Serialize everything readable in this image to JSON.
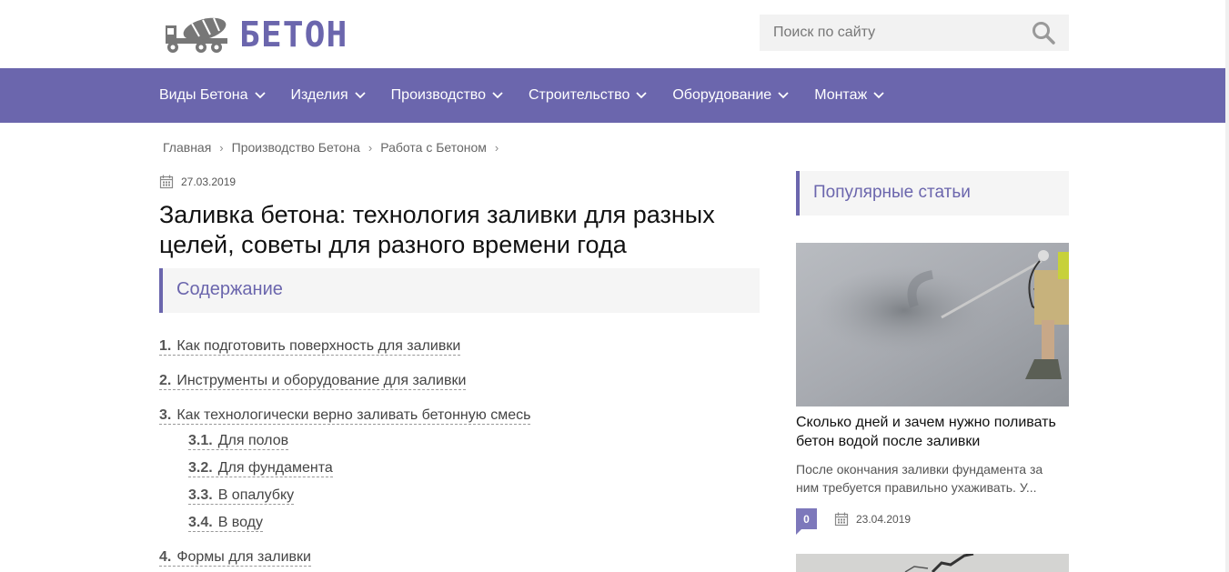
{
  "site": {
    "logo_text": "БЕТОН",
    "logo_icon": "concrete-mixer-truck-icon"
  },
  "search": {
    "placeholder": "Поиск по сайту",
    "icon": "search-icon"
  },
  "nav": {
    "items": [
      {
        "label": "Виды Бетона"
      },
      {
        "label": "Изделия"
      },
      {
        "label": "Производство"
      },
      {
        "label": "Строительство"
      },
      {
        "label": "Оборудование"
      },
      {
        "label": "Монтаж"
      }
    ]
  },
  "breadcrumb": {
    "items": [
      "Главная",
      "Производство Бетона",
      "Работа с Бетоном"
    ],
    "separator": "›"
  },
  "article": {
    "date": "27.03.2019",
    "title": "Заливка бетона: технология заливки для разных целей, советы для разного времени года"
  },
  "toc": {
    "title": "Содержание",
    "items": [
      {
        "num": "1.",
        "label": "Как подготовить поверхность для заливки"
      },
      {
        "num": "2.",
        "label": "Инструменты и оборудование для заливки"
      },
      {
        "num": "3.",
        "label": "Как технологически верно заливать бетонную смесь"
      },
      {
        "num": "3.1.",
        "label": "Для полов"
      },
      {
        "num": "3.2.",
        "label": "Для фундамента"
      },
      {
        "num": "3.3.",
        "label": "В опалубку"
      },
      {
        "num": "3.4.",
        "label": "В воду"
      },
      {
        "num": "4.",
        "label": "Формы для заливки"
      }
    ]
  },
  "sidebar": {
    "title": "Популярные статьи",
    "cards": [
      {
        "title": "Сколько дней и зачем нужно поливать бетон водой после заливки",
        "excerpt": "После окончания заливки фундамента за ним требуется правильно ухаживать. У...",
        "comments": "0",
        "date": "23.04.2019"
      }
    ]
  },
  "colors": {
    "accent": "#6b66ad",
    "badge": "#7d78bb"
  }
}
